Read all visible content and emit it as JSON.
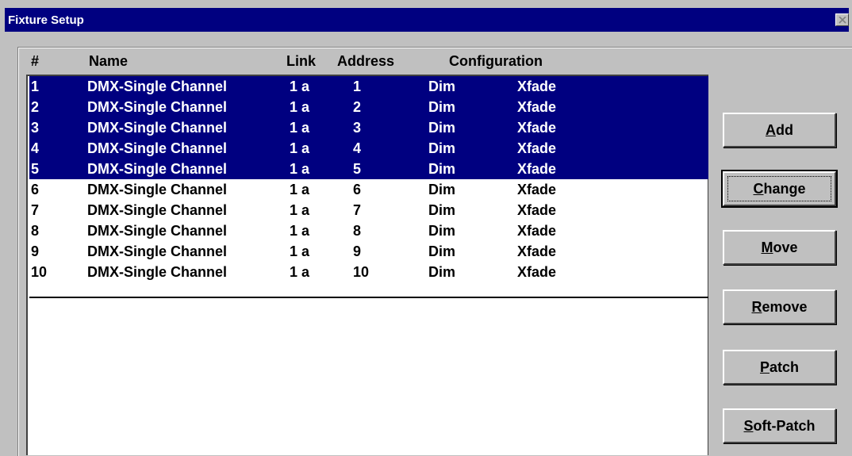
{
  "window": {
    "title": "Fixture Setup"
  },
  "columns": {
    "number": "#",
    "name": "Name",
    "link": "Link",
    "address": "Address",
    "configuration": "Configuration"
  },
  "fixtures": [
    {
      "num": "1",
      "name": "DMX-Single Channel",
      "link": "1 a",
      "address": "1",
      "dim": "Dim",
      "mode": "Xfade",
      "selected": true
    },
    {
      "num": "2",
      "name": "DMX-Single Channel",
      "link": "1 a",
      "address": "2",
      "dim": "Dim",
      "mode": "Xfade",
      "selected": true
    },
    {
      "num": "3",
      "name": "DMX-Single Channel",
      "link": "1 a",
      "address": "3",
      "dim": "Dim",
      "mode": "Xfade",
      "selected": true
    },
    {
      "num": "4",
      "name": "DMX-Single Channel",
      "link": "1 a",
      "address": "4",
      "dim": "Dim",
      "mode": "Xfade",
      "selected": true
    },
    {
      "num": "5",
      "name": "DMX-Single Channel",
      "link": "1 a",
      "address": "5",
      "dim": "Dim",
      "mode": "Xfade",
      "selected": true
    },
    {
      "num": "6",
      "name": "DMX-Single Channel",
      "link": "1 a",
      "address": "6",
      "dim": "Dim",
      "mode": "Xfade",
      "selected": false
    },
    {
      "num": "7",
      "name": "DMX-Single Channel",
      "link": "1 a",
      "address": "7",
      "dim": "Dim",
      "mode": "Xfade",
      "selected": false
    },
    {
      "num": "8",
      "name": "DMX-Single Channel",
      "link": "1 a",
      "address": "8",
      "dim": "Dim",
      "mode": "Xfade",
      "selected": false
    },
    {
      "num": "9",
      "name": "DMX-Single Channel",
      "link": "1 a",
      "address": "9",
      "dim": "Dim",
      "mode": "Xfade",
      "selected": false
    },
    {
      "num": "10",
      "name": "DMX-Single Channel",
      "link": "1 a",
      "address": "10",
      "dim": "Dim",
      "mode": "Xfade",
      "selected": false
    }
  ],
  "buttons": {
    "add": {
      "mnemonic": "A",
      "rest": "dd"
    },
    "change": {
      "mnemonic": "C",
      "rest": "hange"
    },
    "move": {
      "mnemonic": "M",
      "rest": "ove"
    },
    "remove": {
      "mnemonic": "R",
      "rest": "emove"
    },
    "patch": {
      "mnemonic": "P",
      "rest": "atch"
    },
    "soft_patch": {
      "mnemonic": "S",
      "rest": "oft-Patch"
    }
  },
  "icons": {
    "close": "close-icon"
  },
  "colors": {
    "titlebar": "#000080",
    "selection": "#000080",
    "face": "#c0c0c0"
  }
}
